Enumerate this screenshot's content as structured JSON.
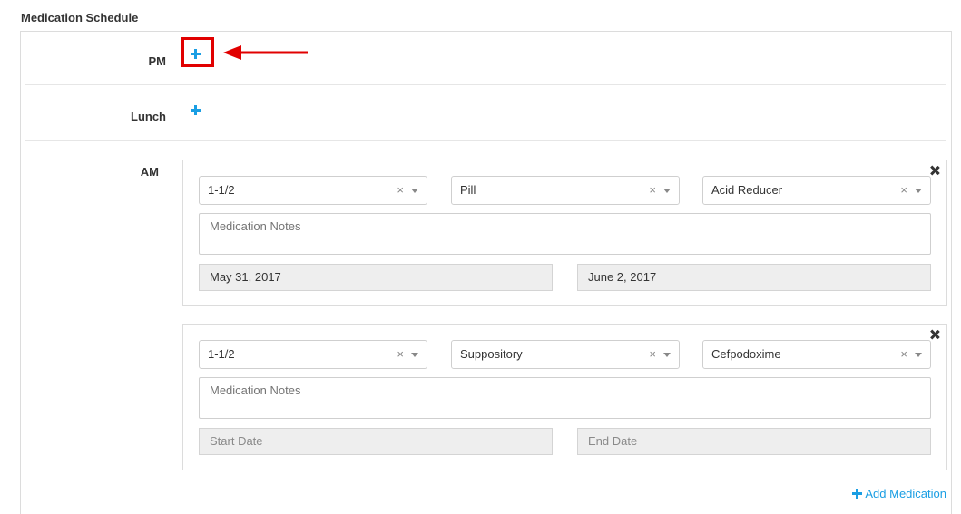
{
  "section": {
    "title": "Medication Schedule"
  },
  "rows": {
    "pm": {
      "label": "PM"
    },
    "lunch": {
      "label": "Lunch"
    },
    "am": {
      "label": "AM"
    }
  },
  "medications": [
    {
      "dose": "1-1/2",
      "form": "Pill",
      "name": "Acid Reducer",
      "notes_placeholder": "Medication Notes",
      "notes_value": "",
      "start_date": "May 31, 2017",
      "end_date": "June 2, 2017"
    },
    {
      "dose": "1-1/2",
      "form": "Suppository",
      "name": "Cefpodoxime",
      "notes_placeholder": "Medication Notes",
      "notes_value": "",
      "start_date": "Start Date",
      "end_date": "End Date"
    }
  ],
  "select_clear_glyph": "×",
  "add_medication_label": "Add Medication",
  "colors": {
    "accent": "#1a9ee3",
    "highlight": "#e10000"
  },
  "icons": [
    "plus-icon",
    "close-icon",
    "chevron-down-icon",
    "arrow-left-icon"
  ]
}
